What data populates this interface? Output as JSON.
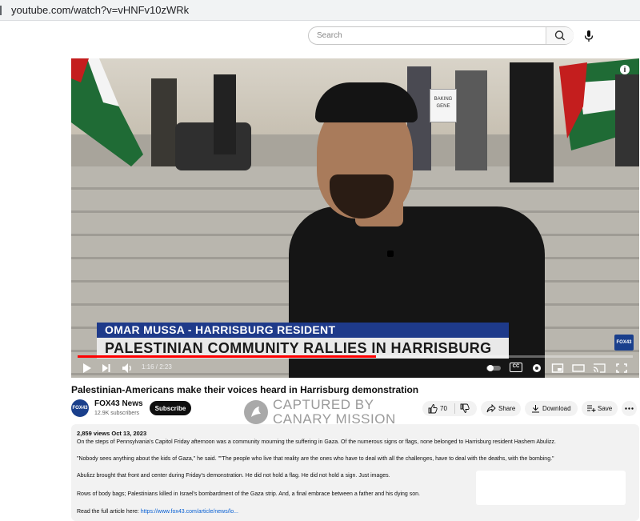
{
  "browser": {
    "url": "youtube.com/watch?v=vHNFv10zWRk"
  },
  "search": {
    "placeholder": "Search"
  },
  "video": {
    "name_banner": "OMAR MUSSA - HARRISBURG RESIDENT",
    "headline_banner": "PALESTINIAN COMMUNITY RALLIES IN HARRISBURG",
    "channel_bug": "FOX43",
    "time": "1:16 / 2:23",
    "progress_fraction": 0.538,
    "cc_label": "CC",
    "sign_text": "BAKING GENE"
  },
  "title": "Palestinian-Americans make their voices heard in Harrisburg demonstration",
  "channel": {
    "logo": "FOX43",
    "name": "FOX43 News",
    "subscribers": "12.9K subscribers",
    "subscribe_label": "Subscribe"
  },
  "watermark": {
    "line1": "CAPTURED BY",
    "line2": "CANARY MISSION"
  },
  "actions": {
    "likes": "70",
    "share": "Share",
    "download": "Download",
    "save": "Save"
  },
  "description": {
    "meta": "2,859 views  Oct 13, 2023",
    "line1": "On the steps of Pennsylvania's Capitol Friday afternoon was a community mourning the suffering in Gaza. Of the numerous signs or flags, none belonged to Harrisburg resident Hashem Abulizz.",
    "line2": "\"Nobody sees anything about the kids of Gaza,\" he said. \"\"The people who live that reality are the ones who have to deal with all the challenges, have to deal with the deaths, with the bombing.\"",
    "line3": "Abulizz brought that front and center during Friday's demonstration. He did not hold a flag. He did not hold a sign. Just images.",
    "line4": "Rows of body bags; Palestinians killed in Israel's bombardment of the Gaza strip. And, a final embrace between a father and his dying son.",
    "line5_prefix": "Read the full article here: ",
    "line5_link": "https://www.fox43.com/article/news/lo..."
  },
  "colors": {
    "progress": "#ff0000",
    "banner_blue": "#1e3a8a",
    "link": "#065fd4"
  }
}
